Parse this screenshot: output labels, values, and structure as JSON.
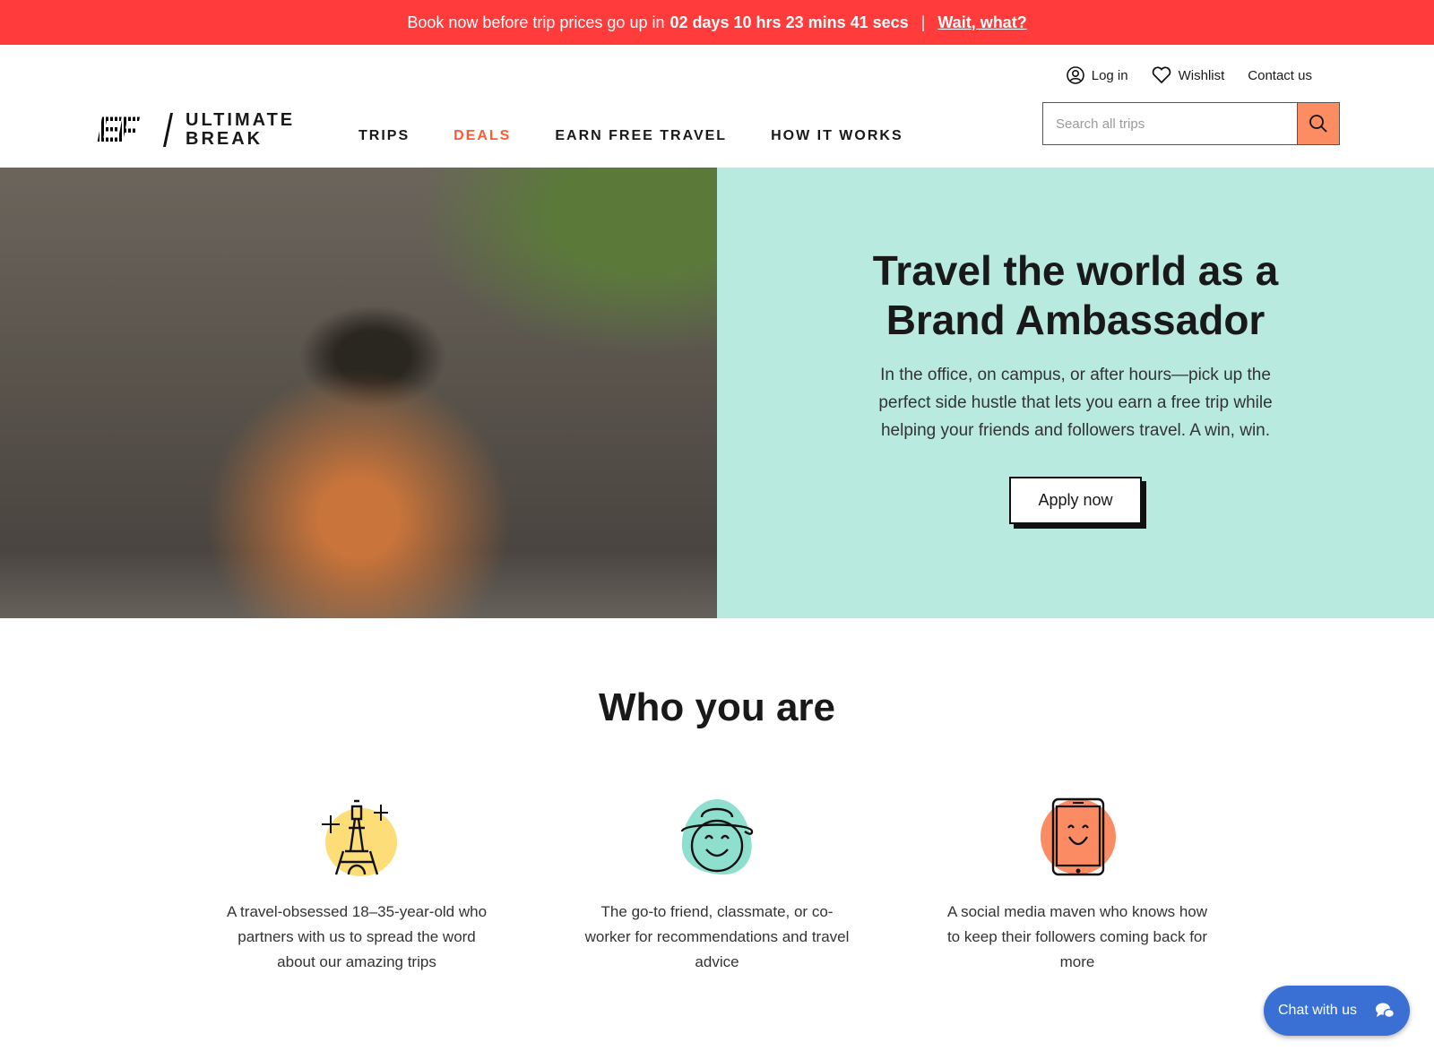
{
  "promo": {
    "text": "Book now before trip prices go up in",
    "countdown": "02 days 10 hrs 23 mins 41 secs",
    "link": "Wait, what?",
    "color": "#ff3b3b"
  },
  "header": {
    "logo_mark": "EF",
    "brand_line1": "ULTIMATE",
    "brand_line2": "BREAK",
    "utility": {
      "login": "Log in",
      "wishlist": "Wishlist",
      "contact": "Contact us"
    },
    "nav": [
      {
        "label": "TRIPS"
      },
      {
        "label": "DEALS",
        "active_color": "#ff5a36"
      },
      {
        "label": "EARN FREE TRAVEL"
      },
      {
        "label": "HOW IT WORKS"
      }
    ],
    "search": {
      "placeholder": "Search all trips",
      "value": ""
    }
  },
  "hero": {
    "title": "Travel the world as a Brand Ambassador",
    "text": "In the office, on campus, or after hours—pick up the perfect side hustle that lets you earn a free trip while helping your friends and followers travel. A win, win.",
    "cta": "Apply now",
    "panel_color": "#b8eadf"
  },
  "who": {
    "title": "Who you are",
    "cards": [
      {
        "icon": "eiffel-tower-icon",
        "text": "A travel-obsessed 18–35-year-old who partners with us to spread the word about our amazing trips"
      },
      {
        "icon": "smiley-hat-icon",
        "text": "The go-to friend, classmate, or co-worker for recommendations and travel advice"
      },
      {
        "icon": "smiley-phone-icon",
        "text": "A social media maven who knows how to keep their followers coming back for more"
      }
    ]
  },
  "chat": {
    "label": "Chat with us",
    "color": "#3a6fd4"
  }
}
